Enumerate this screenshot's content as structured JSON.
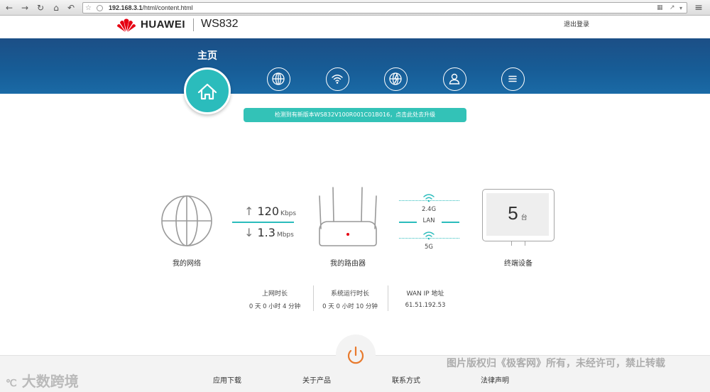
{
  "browser": {
    "url": "192.168.3.1/html/content.html",
    "url_host": "192.168.3.1",
    "url_path": "/html/content.html"
  },
  "header": {
    "brand": "HUAWEI",
    "model": "WS832",
    "logout": "退出登录"
  },
  "nav": {
    "home_label": "主页",
    "items": [
      "globe-icon",
      "wifi-icon",
      "globe-flash-icon",
      "user-icon",
      "menu-icon"
    ]
  },
  "update_banner": "检测到有新版本WS832V100R001C01B016，点击此处去升级",
  "network": {
    "label": "我的网络",
    "up_value": "120",
    "up_unit": "Kbps",
    "down_value": "1.3",
    "down_unit": "Mbps"
  },
  "router": {
    "label": "我的路由器",
    "band_24": "2.4G",
    "lan": "LAN",
    "band_5": "5G"
  },
  "devices": {
    "label": "终端设备",
    "count": "5",
    "unit": "台"
  },
  "stats": [
    {
      "label": "上网时长",
      "value": "0 天 0 小时 4 分钟"
    },
    {
      "label": "系统运行时长",
      "value": "0 天 0 小时 10 分钟"
    },
    {
      "label": "WAN IP 地址",
      "value": "61.51.192.53"
    }
  ],
  "footer": {
    "links": [
      "应用下载",
      "关于产品",
      "联系方式",
      "法律声明"
    ]
  },
  "watermark": {
    "copyright": "图片版权归《极客网》所有，未经许可，禁止转载",
    "site": "大数跨境"
  },
  "colors": {
    "banner": "#1a5c96",
    "teal": "#2bbcbc",
    "power": "#e87a2d"
  }
}
